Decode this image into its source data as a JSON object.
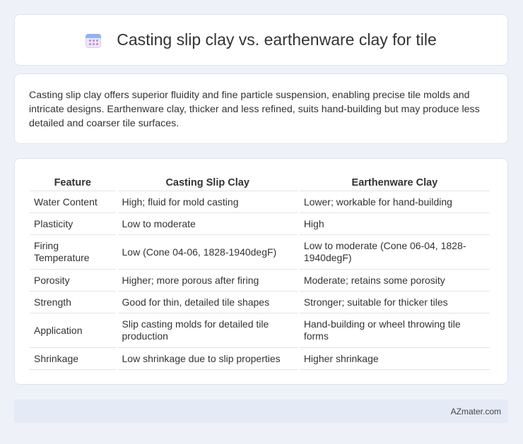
{
  "header": {
    "icon": "calendar-icon",
    "title": "Casting slip clay vs. earthenware clay for tile"
  },
  "summary": {
    "text": "Casting slip clay offers superior fluidity and fine particle suspension, enabling precise tile molds and intricate designs. Earthenware clay, thicker and less refined, suits hand-building but may produce less detailed and coarser tile surfaces."
  },
  "table": {
    "headers": [
      "Feature",
      "Casting Slip Clay",
      "Earthenware Clay"
    ],
    "rows": [
      [
        "Water Content",
        "High; fluid for mold casting",
        "Lower; workable for hand-building"
      ],
      [
        "Plasticity",
        "Low to moderate",
        "High"
      ],
      [
        "Firing Temperature",
        "Low (Cone 04-06, 1828-1940degF)",
        "Low to moderate (Cone 06-04, 1828-1940degF)"
      ],
      [
        "Porosity",
        "Higher; more porous after firing",
        "Moderate; retains some porosity"
      ],
      [
        "Strength",
        "Good for thin, detailed tile shapes",
        "Stronger; suitable for thicker tiles"
      ],
      [
        "Application",
        "Slip casting molds for detailed tile production",
        "Hand-building or wheel throwing tile forms"
      ],
      [
        "Shrinkage",
        "Low shrinkage due to slip properties",
        "Higher shrinkage"
      ]
    ]
  },
  "footer": {
    "brand": "AZmater.com"
  }
}
